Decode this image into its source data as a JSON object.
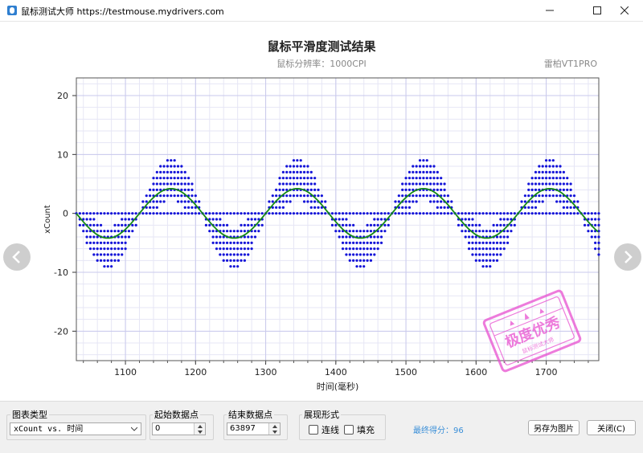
{
  "window": {
    "title": "鼠标测试大师 https://testmouse.mydrivers.com"
  },
  "chart_data": {
    "type": "scatter",
    "title": "鼠标平滑度测试结果",
    "subtitle": "鼠标分辨率：1000CPI",
    "device": "雷柏VT1PRO",
    "xlabel": "时间(毫秒)",
    "ylabel": "xCount",
    "xlim": [
      1030,
      1775
    ],
    "ylim": [
      -25,
      23
    ],
    "xticks": [
      1100,
      1200,
      1300,
      1400,
      1500,
      1600,
      1700
    ],
    "yticks": [
      -20,
      -10,
      0,
      10,
      20
    ],
    "grid": true,
    "series": [
      {
        "kind": "points",
        "color": "#1212d8",
        "period": 180,
        "phase_x": 1075,
        "amplitudes": [
          1,
          2,
          3,
          4,
          5,
          6,
          7,
          8,
          9
        ],
        "x_step": 5
      },
      {
        "kind": "smooth",
        "color": "#158a15",
        "period": 180,
        "trough_x": 1075,
        "amplitude": 4.2
      }
    ]
  },
  "stamp": {
    "text": "极度优秀",
    "subtext": "鼠标测试大师",
    "color": "#e84fd0"
  },
  "controls": {
    "chart_type_label": "图表类型",
    "chart_type_value": "xCount vs. 时间",
    "start_label": "起始数据点",
    "start_value": "0",
    "end_label": "结束数据点",
    "end_value": "63897",
    "style_label": "展现形式",
    "line_label": "连线",
    "fill_label": "填充",
    "score_text": "最终得分：96",
    "save_label": "另存为图片",
    "close_label": "关闭(C)"
  }
}
